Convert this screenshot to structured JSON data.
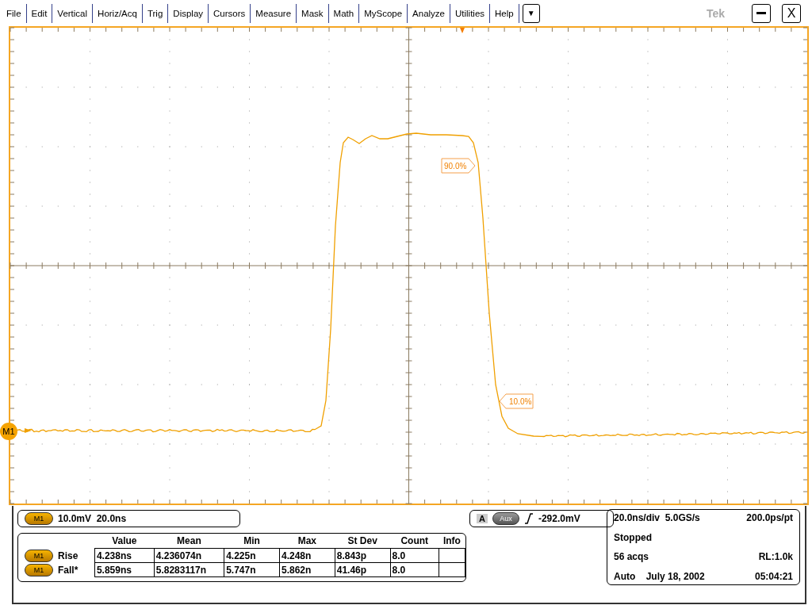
{
  "menu": [
    {
      "label": "File"
    },
    {
      "label": "Edit"
    },
    {
      "label": "Vertical"
    },
    {
      "label": "Horiz/Acq"
    },
    {
      "label": "Trig"
    },
    {
      "label": "Display"
    },
    {
      "label": "Cursors"
    },
    {
      "label": "Measure"
    },
    {
      "label": "Mask"
    },
    {
      "label": "Math"
    },
    {
      "label": "MyScope"
    },
    {
      "label": "Analyze"
    },
    {
      "label": "Utilities"
    },
    {
      "label": "Help"
    }
  ],
  "menu_more": "▼",
  "brand": "Tek",
  "close_label": "X",
  "scope": {
    "channel_label": "M1",
    "markers": [
      {
        "label": "90.0%",
        "kind": "right"
      },
      {
        "label": "10.0%",
        "kind": "left"
      }
    ]
  },
  "scale": {
    "badge": "M1",
    "text": "10.0mV  20.0ns"
  },
  "trigger": {
    "letter": "A",
    "source": "Aux",
    "level": "-292.0mV"
  },
  "measurements": {
    "columns": [
      "Value",
      "Mean",
      "Min",
      "Max",
      "St Dev",
      "Count",
      "Info"
    ],
    "rows": [
      {
        "badge": "M1",
        "name": "Rise",
        "cells": [
          "4.238ns",
          "4.236074n",
          "4.225n",
          "4.248n",
          "8.843p",
          "8.0",
          ""
        ]
      },
      {
        "badge": "M1",
        "name": "Fall*",
        "cells": [
          "5.859ns",
          "5.8283117n",
          "5.747n",
          "5.862n",
          "41.46p",
          "8.0",
          ""
        ]
      }
    ]
  },
  "acquisition": {
    "rows": [
      {
        "left": "20.0ns/div  5.0GS/s",
        "right": "200.0ps/pt"
      },
      {
        "left": "Stopped",
        "right": ""
      },
      {
        "left": "56 acqs",
        "right": "RL:1.0k"
      },
      {
        "left": "Auto    July 18, 2002",
        "right": "05:04:21"
      }
    ]
  }
}
